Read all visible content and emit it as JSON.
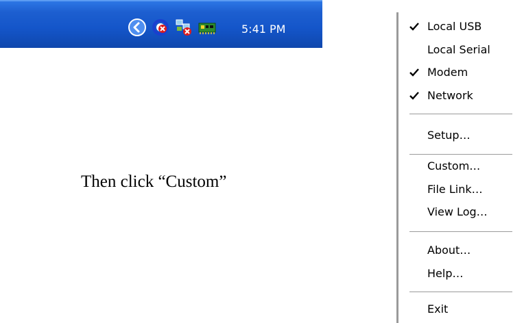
{
  "taskbar": {
    "clock": "5:41 PM",
    "icons": [
      "back-arrow-icon",
      "sync-error-icon",
      "network-error-icon",
      "modem-card-icon"
    ]
  },
  "instruction": "Then click “Custom”",
  "menu": {
    "items": [
      {
        "label": "Local USB",
        "checked": true
      },
      {
        "label": "Local Serial",
        "checked": false
      },
      {
        "label": "Modem",
        "checked": true
      },
      {
        "label": "Network",
        "checked": true
      },
      {
        "label": "Setup…",
        "checked": false
      },
      {
        "label": "Custom…",
        "checked": false
      },
      {
        "label": "File Link…",
        "checked": false
      },
      {
        "label": "View Log…",
        "checked": false
      },
      {
        "label": "About…",
        "checked": false
      },
      {
        "label": "Help…",
        "checked": false
      },
      {
        "label": "Exit",
        "checked": false
      }
    ]
  },
  "colors": {
    "taskbar": "#1455c9",
    "menu_border": "#9a9a9a"
  }
}
